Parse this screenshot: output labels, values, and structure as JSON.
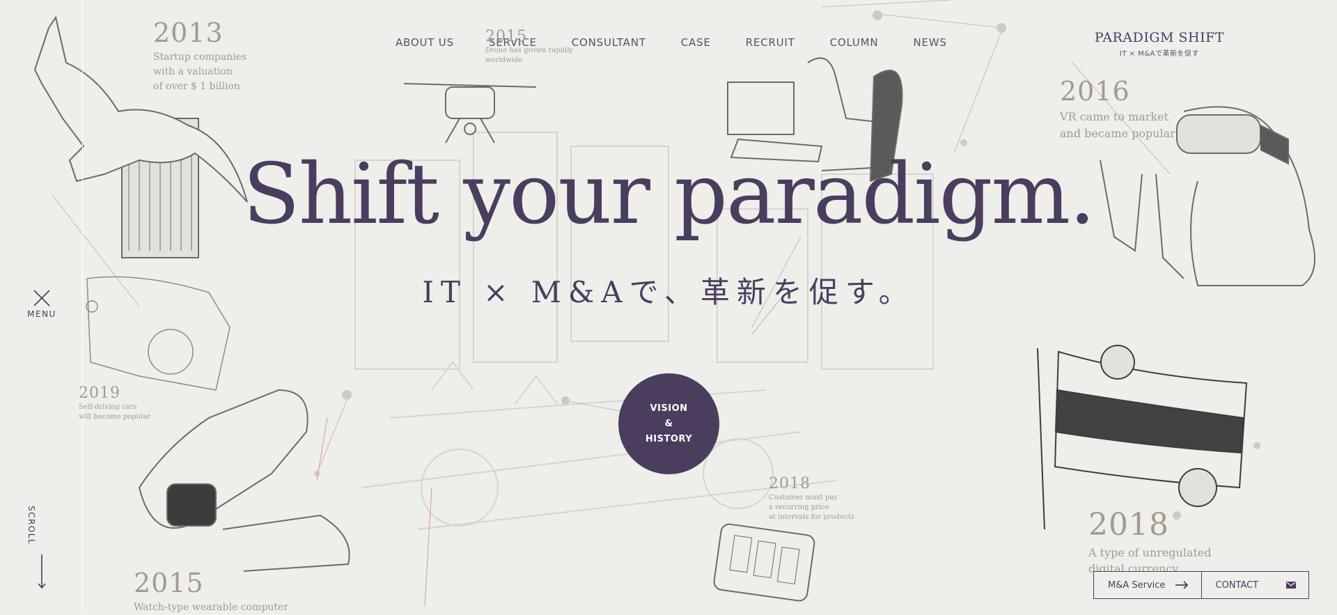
{
  "header": {
    "nav": [
      "ABOUT US",
      "SERVICE",
      "CONSULTANT",
      "CASE",
      "RECRUIT",
      "COLUMN",
      "NEWS"
    ],
    "logo_title": "PARADIGM SHIFT",
    "logo_sub": "IT × M&Aで革新を促す"
  },
  "side": {
    "menu_label": "MENU",
    "scroll_label": "SCROLL"
  },
  "hero": {
    "title": "Shift your paradigm.",
    "subtitle": "IT × M&Aで、革新を促す。",
    "vision_btn": [
      "VISION",
      "&",
      "HISTORY"
    ]
  },
  "notes": {
    "n2013": {
      "year": "2013",
      "lines": [
        "Startup companies",
        "with a valuation",
        "of over $ 1 billion"
      ]
    },
    "n2015a": {
      "year": "2015",
      "lines": [
        "Drone has grown rapidly",
        "worldwide"
      ]
    },
    "n2016": {
      "year": "2016",
      "lines": [
        "VR came to market",
        "and became popular"
      ]
    },
    "n2019": {
      "year": "2019",
      "lines": [
        "Self-driving cars",
        "will become popular"
      ]
    },
    "n2015b": {
      "year": "2015",
      "lines": [
        "Watch-type wearable computer"
      ]
    },
    "n2018a": {
      "year": "2018",
      "lines": [
        "Customer must pay",
        "a recurring price",
        "at intervals for products"
      ]
    },
    "n2018b": {
      "year": "2018",
      "lines": [
        "A type of unregulated",
        "digital currency"
      ]
    }
  },
  "footer_buttons": {
    "ma_service": "M&A Service",
    "contact": "CONTACT"
  },
  "colors": {
    "accent": "#4a3d5e",
    "background": "#eeeeeb",
    "note_text": "#a29a8e",
    "link_lines": "#c44a5a"
  },
  "icons": [
    "close-icon",
    "arrow-down-icon",
    "arrow-right-icon",
    "mail-icon"
  ]
}
